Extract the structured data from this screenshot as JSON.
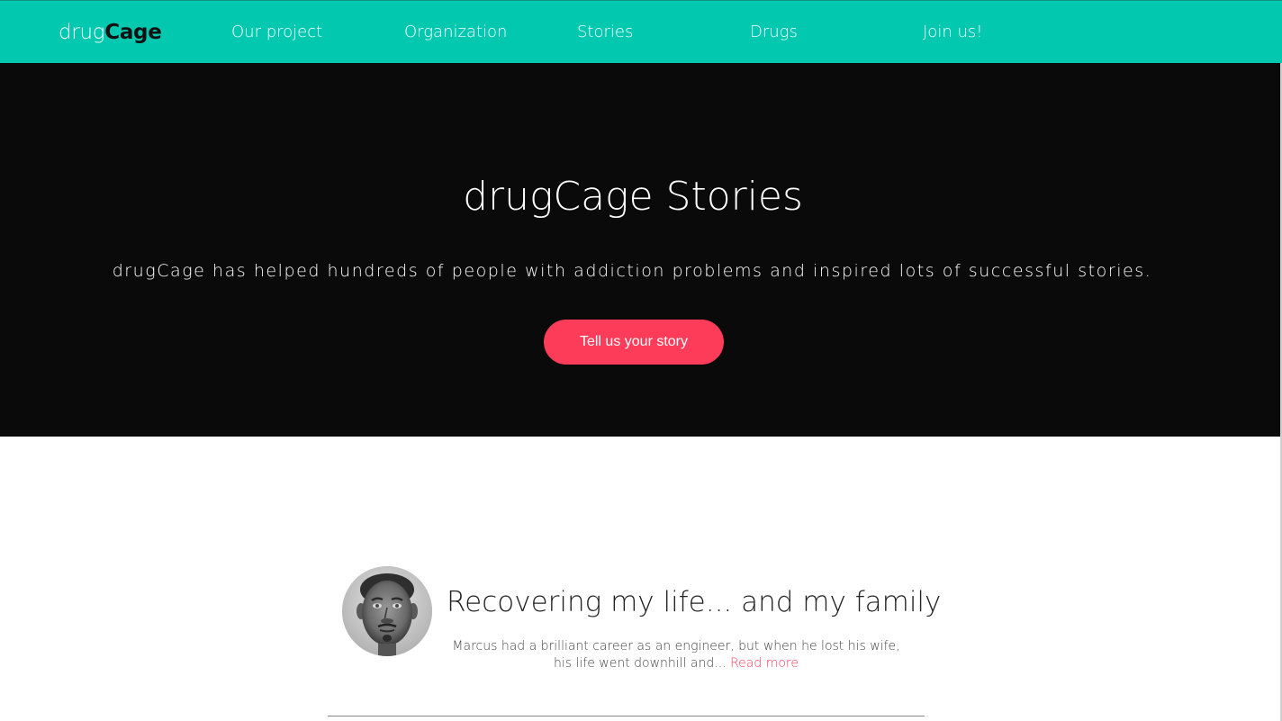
{
  "nav": {
    "brand_light": "drug",
    "brand_bold": "Cage",
    "links": [
      "Our project",
      "Organization",
      "Stories",
      "Drugs",
      "Join us!"
    ]
  },
  "hero": {
    "title": "drugCage Stories",
    "subtitle": "drugCage has helped hundreds of people with addiction problems and inspired lots of successful stories.",
    "cta_label": "Tell us your story"
  },
  "story": {
    "title": "Recovering my life... and my family",
    "excerpt_line1": "Marcus had a brilliant career as an engineer, but when he lost his wife,",
    "excerpt_line2": "his life went downhill and...",
    "read_more": "Read more"
  },
  "colors": {
    "nav_bg": "#02c8af",
    "hero_bg": "#0a0a0a",
    "accent": "#fd3c5a"
  }
}
